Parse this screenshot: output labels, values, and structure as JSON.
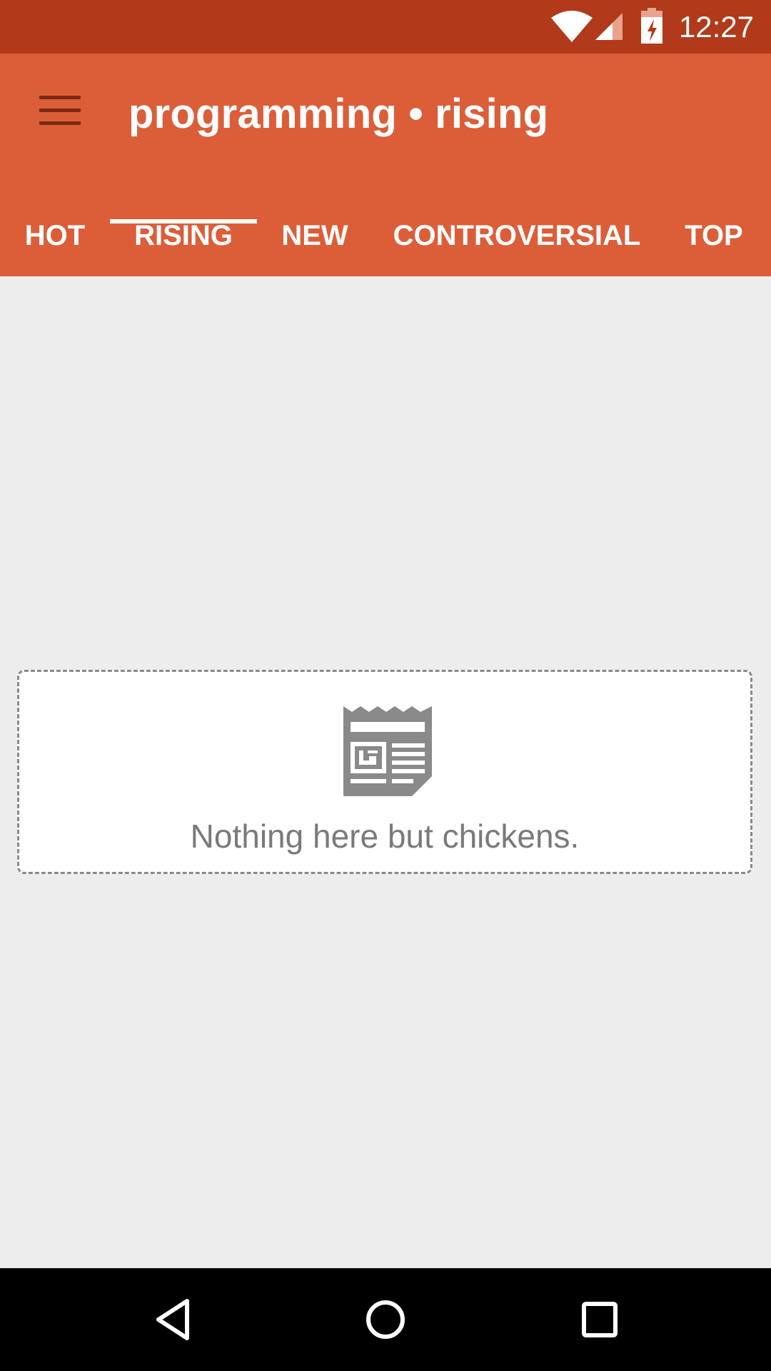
{
  "status_bar": {
    "time": "12:27",
    "icons": [
      "wifi-icon",
      "signal-icon",
      "battery-charging-icon"
    ]
  },
  "app_bar": {
    "title": "programming • rising",
    "menu_icon": "menu-icon"
  },
  "tabs": [
    {
      "label": "HOT",
      "active": false
    },
    {
      "label": "RISING",
      "active": true
    },
    {
      "label": "NEW",
      "active": false
    },
    {
      "label": "CONTROVERSIAL",
      "active": false
    },
    {
      "label": "TOP",
      "active": false
    }
  ],
  "empty_state": {
    "icon": "newspaper-icon",
    "message": "Nothing here but chickens."
  },
  "nav_bar": {
    "icons": [
      "back-icon",
      "home-icon",
      "recents-icon"
    ]
  },
  "colors": {
    "status_bar": "#B03A19",
    "app_bar": "#DB5E39",
    "background": "#EDEDED",
    "nav_bar": "#000000"
  }
}
